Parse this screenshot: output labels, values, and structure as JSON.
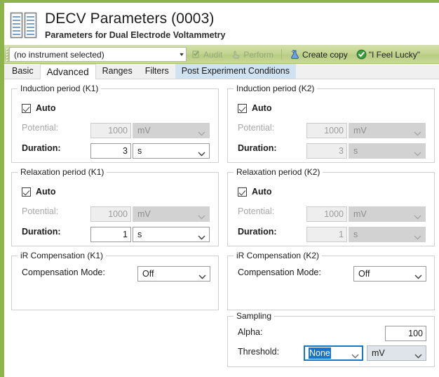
{
  "window": {
    "title": "DECV Parameters (0003)",
    "subtitle": "Parameters for Dual Electrode Voltammetry",
    "icon": "document-pair-icon",
    "accent_color": "#8db34a",
    "toolbar_color": "#c3d490"
  },
  "toolbar": {
    "instrument_value": "(no instrument selected)",
    "instrument_caret": "▾",
    "audit_label": "Audit",
    "perform_label": "Perform",
    "create_copy_label": "Create copy",
    "lucky_label": "\"I Feel Lucky\""
  },
  "tabs": [
    {
      "label": "Basic",
      "state": "normal"
    },
    {
      "label": "Advanced",
      "state": "selected"
    },
    {
      "label": "Ranges",
      "state": "normal"
    },
    {
      "label": "Filters",
      "state": "normal"
    },
    {
      "label": "Post Experiment Conditions",
      "state": "hovered"
    }
  ],
  "groups": {
    "induction_k1": {
      "legend": "Induction period (K1)",
      "auto_label": "Auto",
      "potential_label": "Potential:",
      "potential_value": "1000",
      "potential_unit": "mV",
      "duration_label": "Duration:",
      "duration_value": "3",
      "duration_unit": "s"
    },
    "induction_k2": {
      "legend": "Induction period (K2)",
      "auto_label": "Auto",
      "potential_label": "Potential:",
      "potential_value": "1000",
      "potential_unit": "mV",
      "duration_label": "Duration:",
      "duration_value": "3",
      "duration_unit": "s"
    },
    "relaxation_k1": {
      "legend": "Relaxation period (K1)",
      "auto_label": "Auto",
      "potential_label": "Potential:",
      "potential_value": "1000",
      "potential_unit": "mV",
      "duration_label": "Duration:",
      "duration_value": "1",
      "duration_unit": "s"
    },
    "relaxation_k2": {
      "legend": "Relaxation period (K2)",
      "auto_label": "Auto",
      "potential_label": "Potential:",
      "potential_value": "1000",
      "potential_unit": "mV",
      "duration_label": "Duration:",
      "duration_value": "1",
      "duration_unit": "s"
    },
    "ir_k1": {
      "legend": "iR Compensation (K1)",
      "mode_label": "Compensation Mode:",
      "mode_value": "Off"
    },
    "ir_k2": {
      "legend": "iR Compensation (K2)",
      "mode_label": "Compensation Mode:",
      "mode_value": "Off"
    },
    "sampling": {
      "legend": "Sampling",
      "alpha_label": "Alpha:",
      "alpha_value": "100",
      "threshold_label": "Threshold:",
      "threshold_value": "None",
      "threshold_unit": "mV"
    }
  }
}
